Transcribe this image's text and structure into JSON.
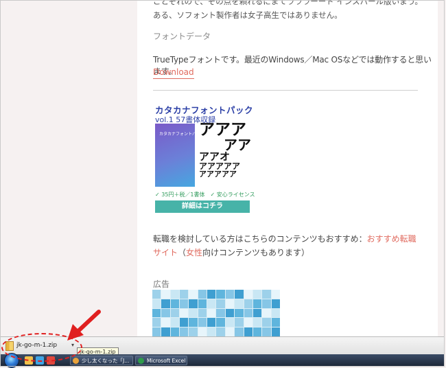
{
  "article": {
    "top_text": "ごとそれので、その点を頼れるにまてラララーード インスパール版いまう。ある、ソフォント製作者は女子高生ではありません。",
    "font_data_heading": "フォントデータ",
    "font_data_text": "TrueTypeフォントです。最近のWindows／Mac OSなどでは動作すると思います。",
    "download_link": "Download",
    "ad_banner": {
      "title": "カタカナフォントパック",
      "subtitle": "vol.1 57書体収録",
      "book_label": "カタカナフォントパック",
      "glyph_lines": [
        "アアア",
        "アア",
        "アアオ",
        "アアアアア",
        "アアアアア"
      ],
      "price_note": "✓ 35円＋税／1書体　✓ 安心ライセンス",
      "details_button": "詳細はコチラ"
    },
    "career_prefix": "転職を検討している方はこちらのコンテンツもおすすめ：",
    "career_link1": "おすすめ転職サイト",
    "career_paren_open": "（",
    "career_link2": "女性",
    "career_suffix": "向けコンテンツもあります）",
    "ad_heading": "広告"
  },
  "download_bar": {
    "file_name": "jk-go-m-1.zip",
    "caret": "▾",
    "tooltip": "jk-go-m-1.zip"
  },
  "taskbar": {
    "tasks": [
      {
        "label": "少し太くなった「J...",
        "icon_color": "#e9a23b"
      },
      {
        "label": "Microsoft Excel - ...",
        "icon_color": "#2f9b4a"
      }
    ]
  },
  "colors": {
    "accent_link": "#e06a5e",
    "annotation_red": "#e02020",
    "ad_button": "#47b3a8"
  }
}
